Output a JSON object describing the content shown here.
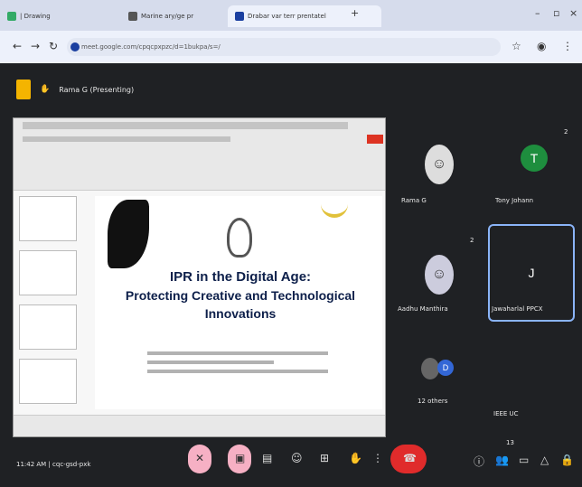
{
  "browser": {
    "tabs": [
      "| Drawing",
      "Marine ary/ge pr",
      "Drabar var terr prentatel"
    ],
    "url": "meet.google.com/cpqcpxpzc/d=1bukpa/s=/"
  },
  "meet": {
    "presenting_label": "Rama G (Presenting)",
    "slide": {
      "title_line1": "IPR in the Digital Age:",
      "title_line2": "Protecting Creative and Technological",
      "title_line3": "Innovations"
    },
    "participants": [
      {
        "name": "Rama G",
        "initial": ""
      },
      {
        "name": "Tony Johann",
        "initial": "T",
        "color": "#1e8e3e"
      },
      {
        "name": "Aadhu Manthira",
        "initial": ""
      },
      {
        "name": "Jawaharlal PPCX",
        "initial": "J"
      },
      {
        "name": "12 others",
        "initial": "D"
      },
      {
        "name": "IEEE UC",
        "initial": ""
      }
    ],
    "counts": [
      "2",
      "2",
      "2"
    ],
    "bottom_left": "11:42 AM | cqc-gsd-pxk",
    "extra_count": "13"
  },
  "colors": {
    "accent": "#8ab4f8",
    "end_call": "#e02b2b"
  }
}
